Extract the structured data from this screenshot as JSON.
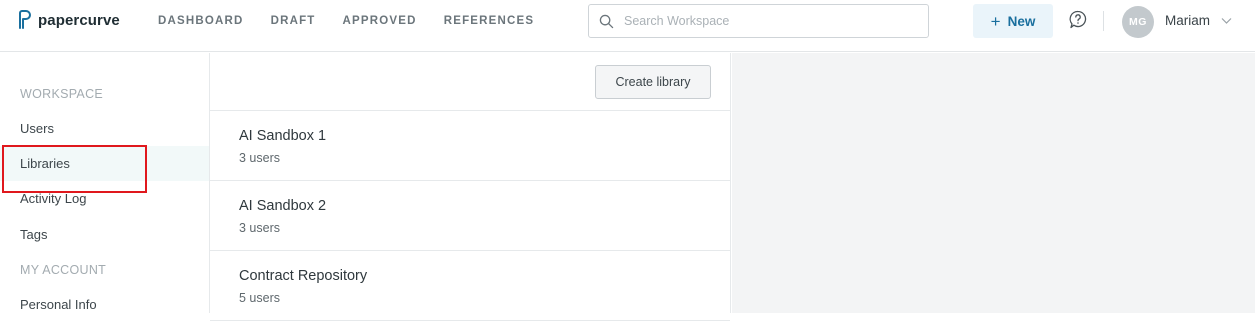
{
  "brand": {
    "name": "papercurve",
    "color": "#1a6f9e"
  },
  "nav": [
    {
      "label": "DASHBOARD"
    },
    {
      "label": "DRAFT"
    },
    {
      "label": "APPROVED"
    },
    {
      "label": "REFERENCES"
    }
  ],
  "search": {
    "placeholder": "Search Workspace",
    "value": ""
  },
  "new_button": {
    "label": "New"
  },
  "user": {
    "initials": "MG",
    "name": "Mariam"
  },
  "sidebar": {
    "workspace_heading": "WORKSPACE",
    "account_heading": "MY ACCOUNT",
    "items": [
      {
        "label": "Users"
      },
      {
        "label": "Libraries",
        "active": true
      },
      {
        "label": "Activity Log"
      },
      {
        "label": "Tags"
      },
      {
        "label": "Personal Info"
      }
    ]
  },
  "main": {
    "create_button": "Create library",
    "libraries": [
      {
        "name": "AI Sandbox 1",
        "count": "3 users"
      },
      {
        "name": "AI Sandbox 2",
        "count": "3 users"
      },
      {
        "name": "Contract Repository",
        "count": "5 users"
      }
    ]
  },
  "colors": {
    "accent": "#1a6f9e",
    "highlight": "#e0181d",
    "active_bg": "#f2f9f9"
  }
}
